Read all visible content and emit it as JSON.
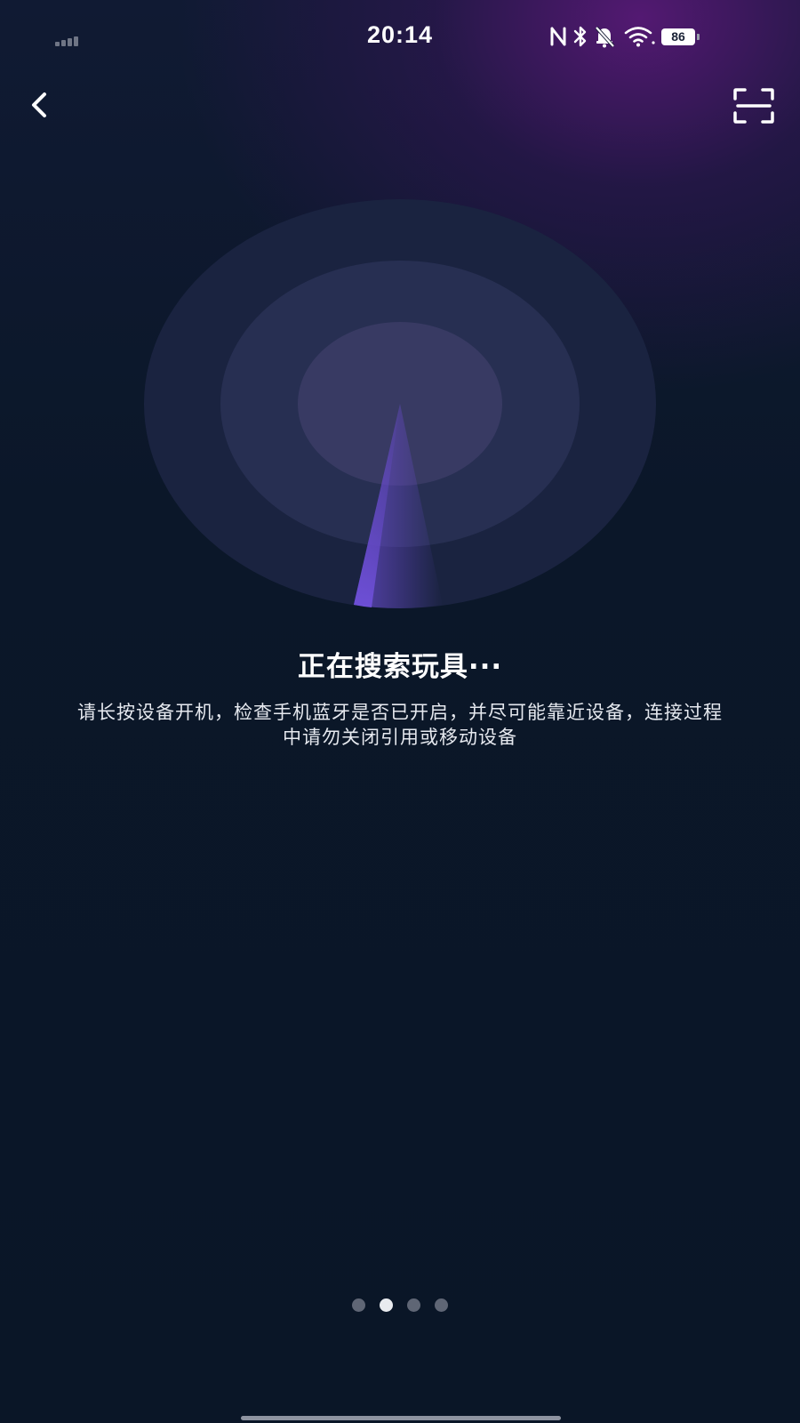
{
  "status_bar": {
    "time": "20:14",
    "battery_level": "86",
    "icons": [
      "signal-icon",
      "nfc-icon",
      "bluetooth-icon",
      "mute-icon",
      "wifi-icon",
      "battery-icon"
    ]
  },
  "nav": {
    "back_icon": "chevron-left-icon",
    "scan_icon": "scan-icon"
  },
  "main": {
    "title": "正在搜索玩具···",
    "description": "请长按设备开机，检查手机蓝牙是否已开启，并尽可能靠近设备，连接过程中请勿关闭引用或移动设备"
  },
  "pager": {
    "count": 4,
    "active_index": 1
  },
  "colors": {
    "background": "#0a1627",
    "accent_purple": "#6a4cd0",
    "top_glow": "#5f197d"
  }
}
